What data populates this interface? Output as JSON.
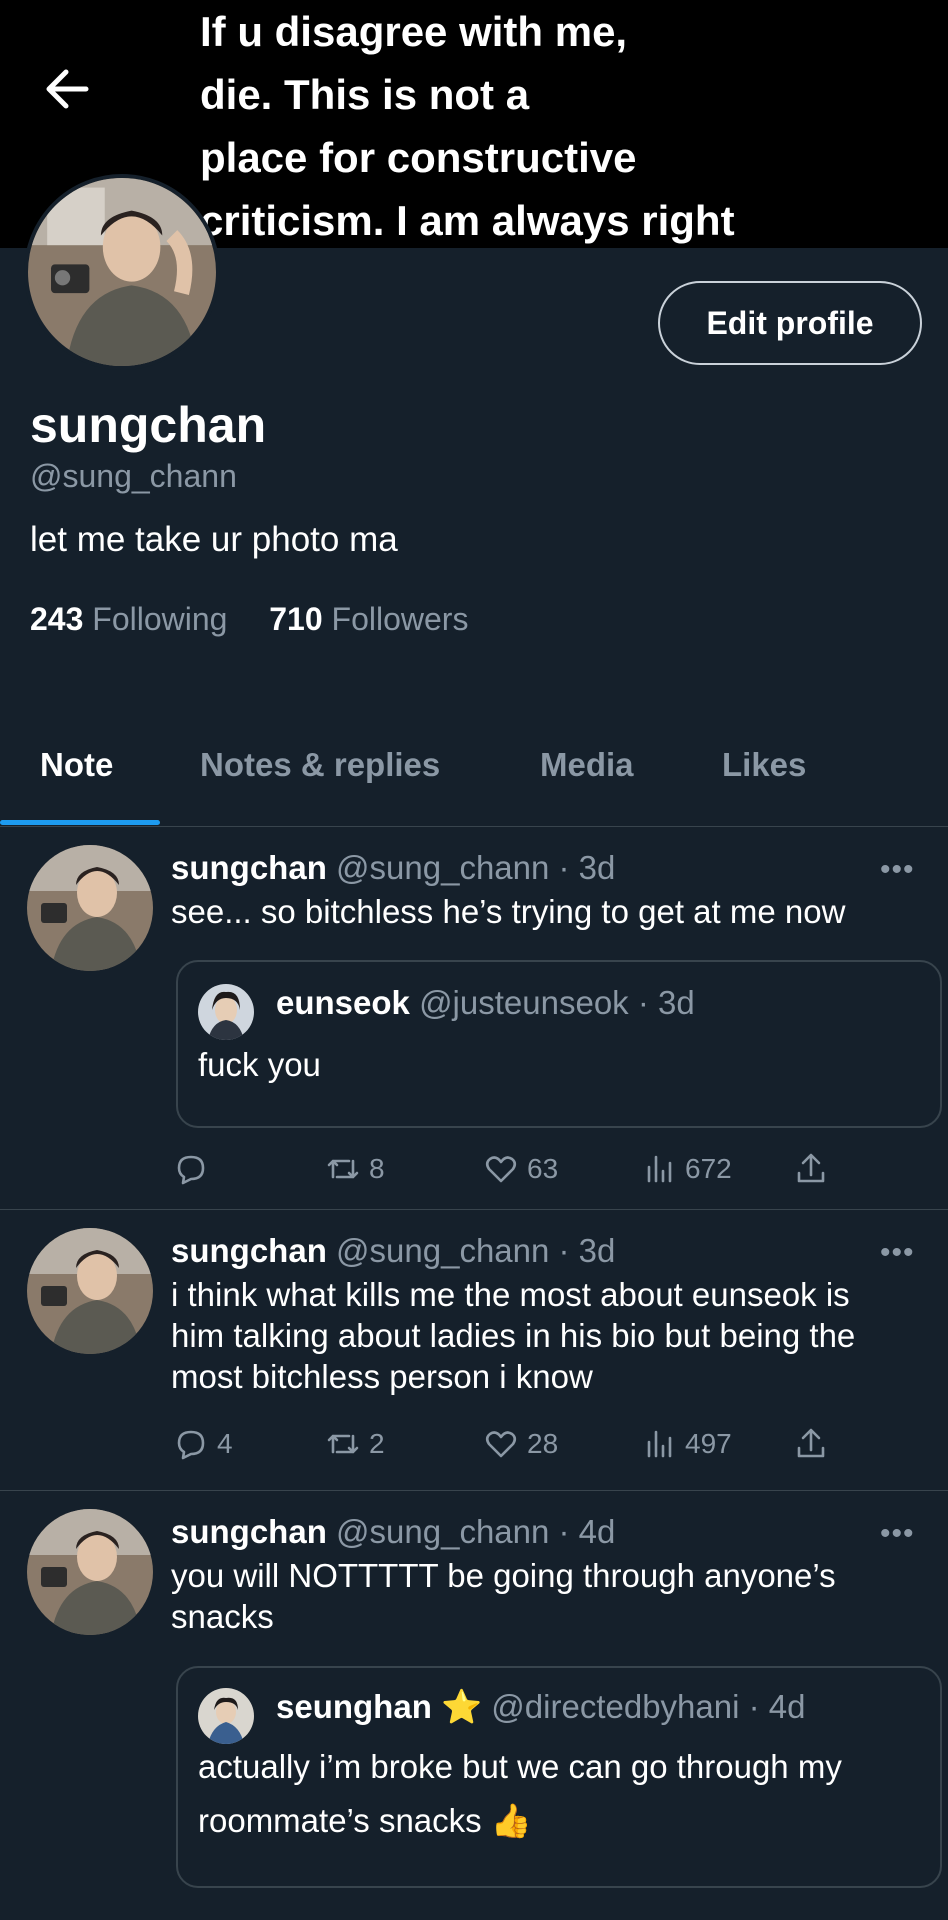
{
  "banner": {
    "text": "If u disagree with me,\ndie.        This is not a\nplace for constructive\ncriticism. I am always right"
  },
  "profile": {
    "edit_label": "Edit profile",
    "name": "sungchan",
    "handle": "@sung_chann",
    "bio": "let me take ur photo ma",
    "following_count": "243",
    "following_label": "Following",
    "followers_count": "710",
    "followers_label": "Followers"
  },
  "tabs": [
    {
      "label": "Note"
    },
    {
      "label": "Notes & replies"
    },
    {
      "label": "Media"
    },
    {
      "label": "Likes"
    }
  ],
  "tweets": [
    {
      "name": "sungchan",
      "meta": "@sung_chann · 3d",
      "text": "see... so bitchless he’s trying to get at me now",
      "quote": {
        "name": "eunseok",
        "meta": "@justeunseok · 3d",
        "text": "fuck you"
      },
      "reply_count": "",
      "retweet_count": "8",
      "like_count": "63",
      "view_count": "672"
    },
    {
      "name": "sungchan",
      "meta": "@sung_chann · 3d",
      "text": "i think what kills me the most about eunseok is him talking about ladies in his bio but being the most bitchless person i know",
      "reply_count": "4",
      "retweet_count": "2",
      "like_count": "28",
      "view_count": "497"
    },
    {
      "name": "sungchan",
      "meta": "@sung_chann · 4d",
      "text": "you will NOTTTTT be going through anyone’s snacks",
      "quote": {
        "name": "seunghan",
        "badge": "⭐",
        "meta": "@directedbyhani · 4d",
        "text": "actually i’m broke but we can go through my roommate’s snacks 👍"
      }
    }
  ],
  "more_label": "•••",
  "colors": {
    "background": "#15202b",
    "accent": "#1d9bf0",
    "muted": "#8b98a5",
    "border": "#38444d"
  }
}
